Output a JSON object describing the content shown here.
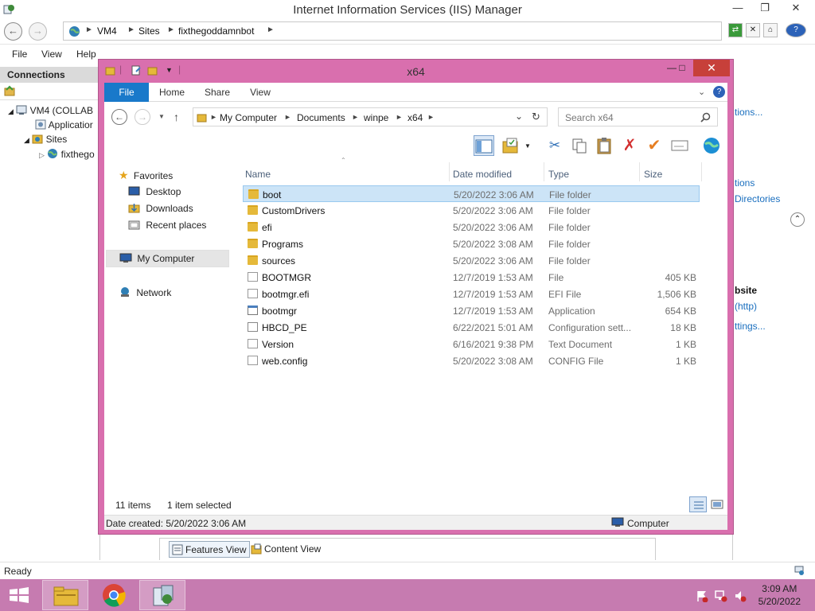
{
  "iis": {
    "title": "Internet Information Services (IIS) Manager",
    "breadcrumb": [
      "VM4",
      "Sites",
      "fixthegoddamnbot"
    ],
    "menu": [
      "File",
      "View",
      "Help"
    ],
    "connections_label": "Connections",
    "tree": {
      "server": "VM4 (COLLAB",
      "app_pools": "Applicatior",
      "sites": "Sites",
      "site": "fixthego"
    },
    "actions": {
      "link1": "tions...",
      "link2": "tions",
      "link3": "Directories",
      "browse_heading": "bsite",
      "browse_link": "(http)",
      "settings_link": "ttings..."
    },
    "views": {
      "features": "Features View",
      "content": "Content View"
    },
    "status": "Ready"
  },
  "explorer": {
    "title": "x64",
    "ribbon_tabs": [
      "File",
      "Home",
      "Share",
      "View"
    ],
    "address": [
      "My Computer",
      "Documents",
      "winpe",
      "x64"
    ],
    "search_placeholder": "Search x64",
    "nav": {
      "favorites": "Favorites",
      "desktop": "Desktop",
      "downloads": "Downloads",
      "recent": "Recent places",
      "computer": "My Computer",
      "network": "Network"
    },
    "columns": {
      "name": "Name",
      "date": "Date modified",
      "type": "Type",
      "size": "Size"
    },
    "files": [
      {
        "name": "boot",
        "date": "5/20/2022 3:06 AM",
        "type": "File folder",
        "size": "",
        "icon": "folder"
      },
      {
        "name": "CustomDrivers",
        "date": "5/20/2022 3:06 AM",
        "type": "File folder",
        "size": "",
        "icon": "folder"
      },
      {
        "name": "efi",
        "date": "5/20/2022 3:06 AM",
        "type": "File folder",
        "size": "",
        "icon": "folder"
      },
      {
        "name": "Programs",
        "date": "5/20/2022 3:08 AM",
        "type": "File folder",
        "size": "",
        "icon": "folder"
      },
      {
        "name": "sources",
        "date": "5/20/2022 3:06 AM",
        "type": "File folder",
        "size": "",
        "icon": "folder"
      },
      {
        "name": "BOOTMGR",
        "date": "12/7/2019 1:53 AM",
        "type": "File",
        "size": "405 KB",
        "icon": "file"
      },
      {
        "name": "bootmgr.efi",
        "date": "12/7/2019 1:53 AM",
        "type": "EFI File",
        "size": "1,506 KB",
        "icon": "file"
      },
      {
        "name": "bootmgr",
        "date": "12/7/2019 1:53 AM",
        "type": "Application",
        "size": "654 KB",
        "icon": "app"
      },
      {
        "name": "HBCD_PE",
        "date": "6/22/2021 5:01 AM",
        "type": "Configuration sett...",
        "size": "18 KB",
        "icon": "config"
      },
      {
        "name": "Version",
        "date": "6/16/2021 9:38 PM",
        "type": "Text Document",
        "size": "1 KB",
        "icon": "file"
      },
      {
        "name": "web.config",
        "date": "5/20/2022 3:08 AM",
        "type": "CONFIG File",
        "size": "1 KB",
        "icon": "file"
      }
    ],
    "selected_index": 0,
    "status": {
      "items": "11 items",
      "selected": "1 item selected"
    },
    "details": {
      "date_created": "Date created: 5/20/2022 3:06 AM",
      "location": "Computer"
    }
  },
  "taskbar": {
    "time": "3:09 AM",
    "date": "5/20/2022"
  },
  "colors": {
    "accent": "#d96fae",
    "taskbar": "#c67bb0",
    "file_tab": "#1979ca",
    "close_button": "#c7403a",
    "selection": "#cce4f7"
  }
}
